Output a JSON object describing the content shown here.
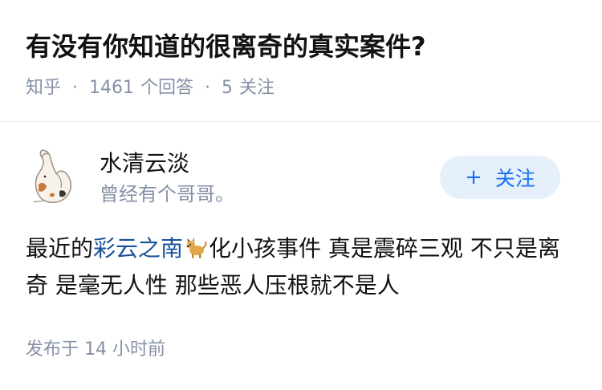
{
  "question": {
    "title": "有没有你知道的很离奇的真实案件?",
    "source": "知乎",
    "answer_count": "1461",
    "answer_label": "个回答",
    "follower_count": "5",
    "follower_label": "关注"
  },
  "author": {
    "name": "水清云淡",
    "bio": "曾经有个哥哥。",
    "avatar_icon": "cat-avatar-icon",
    "follow_button_label": "关注",
    "follow_icon": "plus-icon"
  },
  "answer": {
    "text_before_link": "最近的",
    "link_text": "彩云之南",
    "emoji": "dog-emoji-icon",
    "text_after_link": "化小孩事件 真是震碎三观 不只是离奇 是毫无人性 那些恶人压根就不是人",
    "published": "发布于  14 小时前"
  },
  "colors": {
    "meta_gray": "#8590a6",
    "link_blue": "#175199",
    "button_blue": "#1772f6",
    "button_bg": "#e6f0fb"
  }
}
